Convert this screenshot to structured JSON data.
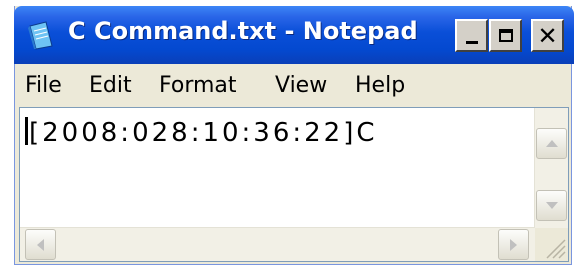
{
  "window": {
    "title": "C Command.txt - Notepad"
  },
  "menu": {
    "file": "File",
    "edit": "Edit",
    "format": "Format",
    "view": "View",
    "help": "Help"
  },
  "editor": {
    "text": "[2008:028:10:36:22]C"
  },
  "icons": {
    "app": "notepad-icon",
    "minimize": "minimize-icon",
    "maximize": "maximize-icon",
    "close": "close-icon",
    "scroll_up": "scroll-up-arrow-icon",
    "scroll_down": "scroll-down-arrow-icon",
    "scroll_left": "scroll-left-arrow-icon",
    "scroll_right": "scroll-right-arrow-icon",
    "resize_grip": "resize-grip-icon"
  },
  "colors": {
    "titlebar": "#0a4fd8",
    "chrome": "#ece9d8",
    "editor_bg": "#ffffff"
  }
}
